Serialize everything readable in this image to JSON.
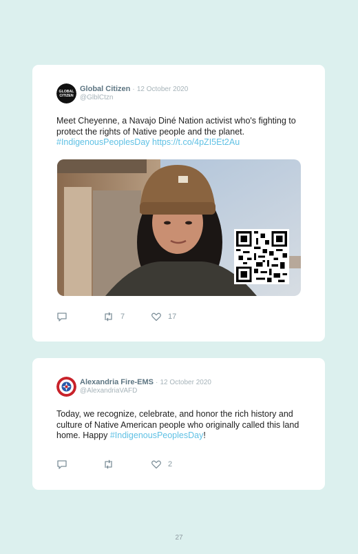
{
  "tweets": [
    {
      "name": "Global Citizen",
      "separator": "·",
      "date": "12 October 2020",
      "handle": "@GlblCtzn",
      "avatar_text": "GLOBAL CITIZEN",
      "text_before": "Meet Cheyenne, a Navajo Diné Nation activist who's fighting to protect the rights of Native people and the planet. ",
      "hashtag": "#IndigenousPeoplesDay",
      "link": "https://t.co/4pZI5Et2Au",
      "image": "photo of a young woman in a brown beanie outdoors",
      "qr_icon": "qr-code-icon",
      "replies": "",
      "retweets": "7",
      "likes": "17"
    },
    {
      "name": "Alexandria Fire-EMS",
      "separator": "·",
      "date": "12 October 2020",
      "handle": "@AlexandriaVAFD",
      "text_before": "Today, we recognize, celebrate, and honor the rich history and culture of Native American people who originally called this land home. Happy ",
      "hashtag": "#IndigenousPeoplesDay",
      "text_after": "!",
      "replies": "",
      "retweets": "",
      "likes": "2"
    }
  ],
  "icons": {
    "reply": "reply-icon",
    "retweet": "retweet-icon",
    "like": "heart-icon"
  },
  "colors": {
    "background": "#dcf0ee",
    "card": "#ffffff",
    "hashtag": "#5ec0e4",
    "name": "#5d7582"
  },
  "page_number": "27"
}
